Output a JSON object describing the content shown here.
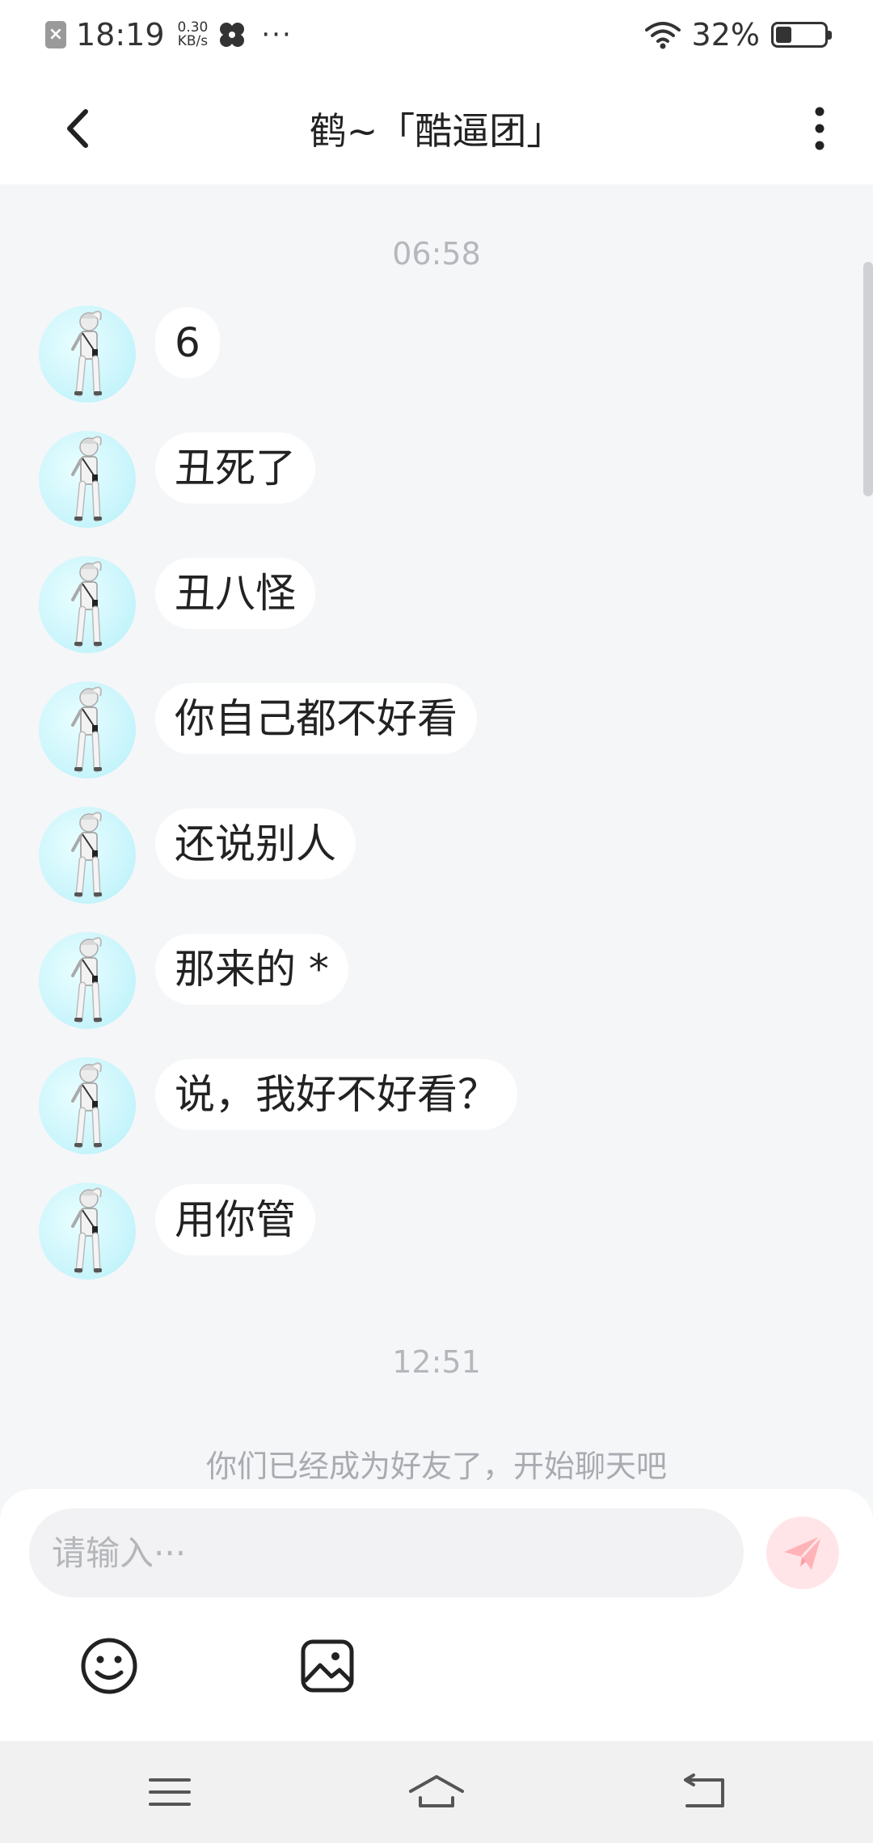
{
  "status_bar": {
    "time": "18:19",
    "speed_value": "0.30",
    "speed_unit": "KB/s",
    "more": "···",
    "battery": "32%",
    "battery_level": 0.32
  },
  "header": {
    "title": "鹤~「酷逼团」"
  },
  "chat": {
    "timestamp_1": "06:58",
    "messages": [
      {
        "text": "6"
      },
      {
        "text": "丑死了"
      },
      {
        "text": "丑八怪"
      },
      {
        "text": "你自己都不好看"
      },
      {
        "text": "还说别人"
      },
      {
        "text": "那来的 *"
      },
      {
        "text": "说，我好不好看？"
      },
      {
        "text": "用你管"
      }
    ],
    "timestamp_2": "12:51",
    "system_note": "你们已经成为好友了，开始聊天吧"
  },
  "input": {
    "placeholder": "请输入···",
    "value": ""
  },
  "colors": {
    "send_button_bg": "#ffe5e7",
    "send_icon": "#ffb3b8",
    "avatar_bg": "#c6f4fb"
  },
  "icons": {
    "back": "chevron-left-icon",
    "more": "more-vertical-icon",
    "send": "paper-plane-icon",
    "emoji": "smiley-icon",
    "image": "image-icon",
    "nav_menu": "menu-icon",
    "nav_home": "home-icon",
    "nav_back": "back-icon"
  }
}
